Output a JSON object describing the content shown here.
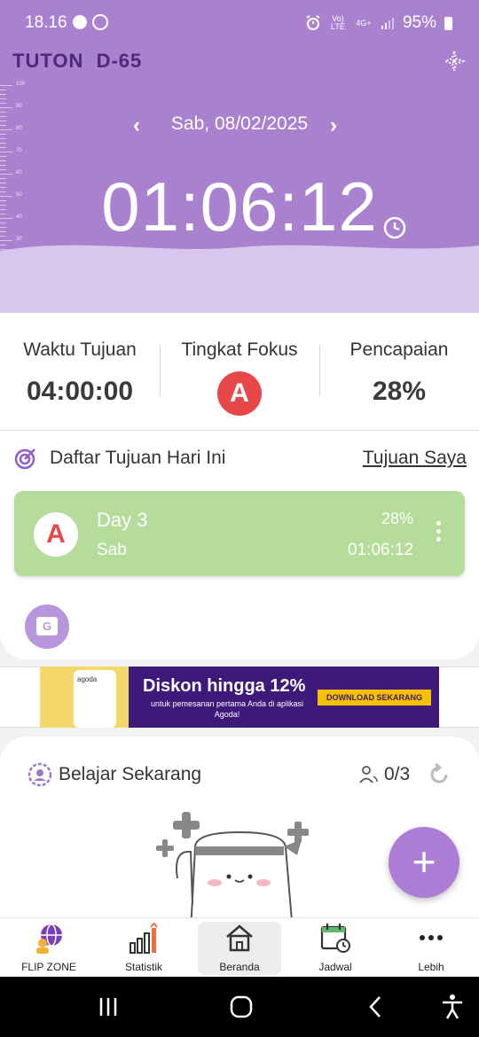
{
  "status_bar": {
    "time": "18.16",
    "network": "Vo) LTE",
    "network_type": "4G+",
    "battery": "95%"
  },
  "header": {
    "app_title": "TUTON  D-65",
    "ruler_labels": [
      "100",
      "90",
      "80",
      "70",
      "60",
      "50",
      "40",
      "30",
      "20",
      "10",
      "0"
    ],
    "date": "Sab, 08/02/2025",
    "elapsed_time": "01:06:12",
    "fill_level_percent": 28
  },
  "stats": {
    "target_time": {
      "label": "Waktu Tujuan",
      "value": "04:00:00"
    },
    "focus_level": {
      "label": "Tingkat Fokus",
      "grade": "A"
    },
    "achievement": {
      "label": "Pencapaian",
      "value": "28%"
    }
  },
  "goals": {
    "title": "Daftar Tujuan Hari Ini",
    "link_label": "Tujuan Saya",
    "items": [
      {
        "grade": "A",
        "name": "Day 3",
        "day": "Sab",
        "percent": "28%",
        "duration": "01:06:12"
      }
    ],
    "group_icon_letter": "G"
  },
  "ad": {
    "brand": "agoda",
    "headline": "Diskon hingga 12%",
    "subtext": "untuk pemesanan pertama Anda di aplikasi Agoda!",
    "cta": "DOWNLOAD SEKARANG"
  },
  "study": {
    "title": "Belajar Sekarang",
    "count": "0/3"
  },
  "bottom_nav": {
    "items": [
      {
        "label": "FLIP ZONE",
        "icon": "globe-people-icon",
        "active": false
      },
      {
        "label": "Statistik",
        "icon": "bar-chart-icon",
        "active": false
      },
      {
        "label": "Beranda",
        "icon": "home-icon",
        "active": true
      },
      {
        "label": "Jadwal",
        "icon": "calendar-clock-icon",
        "active": false
      },
      {
        "label": "Lebih",
        "icon": "more-dots-icon",
        "active": false
      }
    ]
  },
  "colors": {
    "header_purple": "#a981cf",
    "title_purple": "#4a2a7a",
    "grade_red": "#e8474a",
    "goal_green": "#b5dc9a",
    "fab_purple": "#ad7dd5"
  }
}
